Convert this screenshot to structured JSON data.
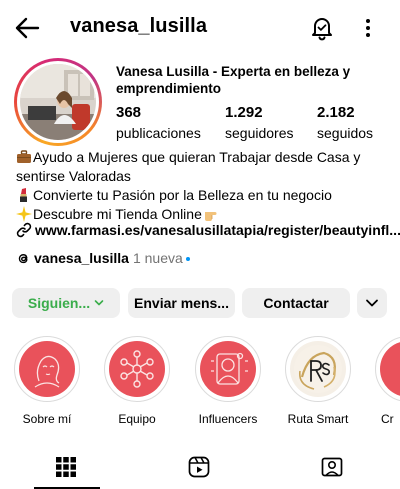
{
  "header": {
    "username": "vanesa_lusilla"
  },
  "profile": {
    "display_name": "Vanesa Lusilla - Experta en belleza y emprendimiento",
    "stats": [
      {
        "value": "368",
        "label": "publicaciones"
      },
      {
        "value": "1.292",
        "label": "seguidores"
      },
      {
        "value": "2.182",
        "label": "seguidos"
      }
    ],
    "bio": [
      {
        "icon": "briefcase-emoji",
        "text": "Ayudo a Mujeres que quieran Trabajar desde Casa y"
      },
      {
        "icon": "",
        "text": "sentirse Valoradas"
      },
      {
        "icon": "lipstick-emoji",
        "text": "Convierte tu Pasión por la Belleza en tu negocio"
      },
      {
        "icon": "sparkle-emoji",
        "text": "Descubre mi Tienda Online"
      }
    ],
    "link": "www.farmasi.es/vanesalusillatapia/register/beautyinfl...",
    "threads": {
      "handle": "vanesa_lusilla",
      "badge": "1 nueva"
    }
  },
  "actions": {
    "following_label": "Siguien...",
    "message_label": "Enviar mens...",
    "contact_label": "Contactar"
  },
  "highlights": [
    {
      "label": "Sobre mí",
      "icon": "woman-face-icon"
    },
    {
      "label": "Equipo",
      "icon": "team-network-icon"
    },
    {
      "label": "Influencers",
      "icon": "influencer-camera-icon"
    },
    {
      "label": "Ruta Smart",
      "icon": "rs-monogram-icon"
    },
    {
      "label": "Cr",
      "icon": "highlight-icon"
    }
  ],
  "tabs": [
    {
      "name": "grid-icon",
      "active": true
    },
    {
      "name": "reels-icon",
      "active": false
    },
    {
      "name": "tagged-icon",
      "active": false
    }
  ],
  "colors": {
    "following_green": "#3aad4b",
    "highlight_red": "#e9525b",
    "button_bg": "#efefef",
    "threads_dot": "#0095f6"
  }
}
